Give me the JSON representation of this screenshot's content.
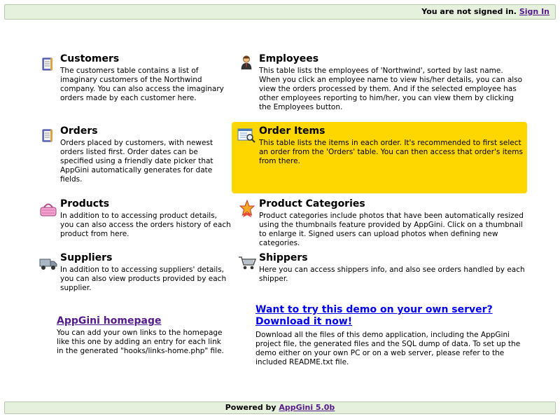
{
  "header": {
    "status_text": "You are not signed in.",
    "sign_in_label": "Sign In"
  },
  "tables": [
    {
      "icon": "book-icon",
      "title": "Customers",
      "description": "The customers table contains a list of imaginary customers of the Northwind company. You can also access the imaginary orders made by each customer here."
    },
    {
      "icon": "employee-icon",
      "title": "Employees",
      "description": "This table lists the employees of 'Northwind', sorted by last name. When you click an employee name to view his/her details, you can also view the orders processed by them. And if the selected employee has other employees reporting to him/her, you can view them by clicking the Employees button."
    },
    {
      "icon": "book-icon",
      "title": "Orders",
      "description": "Orders placed by customers, with newest orders listed first. Order dates can be specified using a friendly date picker that AppGini automatically generates for date fields."
    },
    {
      "icon": "order-items-icon",
      "title": "Order Items",
      "description": "This table lists the items in each order. It's recommended to first select an order from the 'Orders' table. You can then access that order's items from there.",
      "highlight": "#ffd700"
    },
    {
      "icon": "basket-icon",
      "title": "Products",
      "description": "In addition to to accessing product details, you can also access the orders history of each product from here."
    },
    {
      "icon": "star-icon",
      "title": "Product Categories",
      "description": "Product categories include photos that have been automatically resized using the thumbnails feature provided by AppGini. Click on a thumbnail to enlarge it. Signed users can upload photos when defining new categories."
    },
    {
      "icon": "truck-icon",
      "title": "Suppliers",
      "description": "In addition to to accessing suppliers' details, you can also view products provided by each supplier."
    },
    {
      "icon": "cart-icon",
      "title": "Shippers",
      "description": "Here you can access shippers info, and also see orders handled by each shipper."
    }
  ],
  "links": [
    {
      "title": "AppGini homepage",
      "description": "You can add your own links to the homepage like this one by adding an entry for each link in the generated \"hooks/links-home.php\" file."
    },
    {
      "title": "Want to try this demo on your own server? Download it now!",
      "description": "Download all the files of this demo application, including the AppGini project file, the generated files and the SQL dump of data. To set up the demo either on your own PC or on a web server, please refer to the included README.txt file."
    }
  ],
  "footer": {
    "powered_by": "Powered by",
    "link_label": "AppGini 5.0b"
  },
  "colors": {
    "bar_background": "#e5f0dd",
    "highlight": "#ffd700",
    "visited_link": "#551a8b",
    "link": "#0000ee"
  }
}
